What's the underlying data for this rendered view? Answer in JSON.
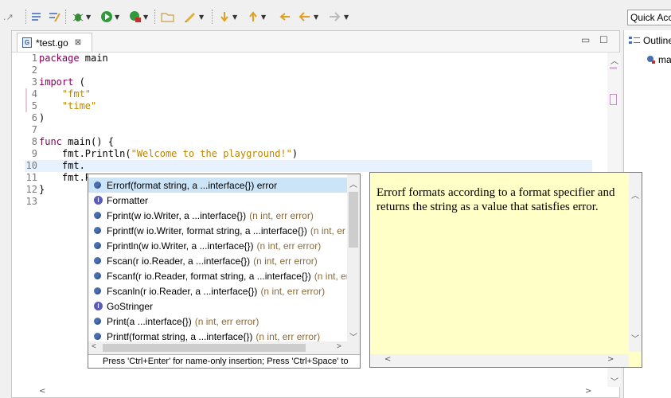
{
  "toolbar": {
    "quick_access": "Quick Acc",
    "icons": [
      "undo-redo-icon",
      "format-icon",
      "annotation-icon",
      "debug-icon",
      "run-icon",
      "run-config-icon",
      "new-folder-icon",
      "pen-icon",
      "next-annotation-icon",
      "prev-annotation-icon",
      "back-icon",
      "forward-icon"
    ]
  },
  "editor": {
    "tab_title": "*test.go",
    "tab_icon": "G",
    "tab_close": "⊠",
    "lines": [
      {
        "n": "1",
        "text": "package main"
      },
      {
        "n": "2",
        "text": ""
      },
      {
        "n": "3",
        "text": "import ("
      },
      {
        "n": "4",
        "text": "    \"fmt\""
      },
      {
        "n": "5",
        "text": "    \"time\""
      },
      {
        "n": "6",
        "text": ")"
      },
      {
        "n": "7",
        "text": ""
      },
      {
        "n": "8",
        "text": "func main() {"
      },
      {
        "n": "9",
        "text": "    fmt.Println(\"Welcome to the playground!\")"
      },
      {
        "n": "10",
        "text": "    fmt."
      },
      {
        "n": "11",
        "text": "    fmt.P"
      },
      {
        "n": "12",
        "text": "}"
      },
      {
        "n": "13",
        "text": ""
      }
    ]
  },
  "outline": {
    "title": "Outline",
    "item": "ma"
  },
  "completion": {
    "items": [
      {
        "kind": "func",
        "name": "Errorf(format string, a ...interface{}) error",
        "ret": ""
      },
      {
        "kind": "iface",
        "name": "Formatter",
        "ret": ""
      },
      {
        "kind": "func",
        "name": "Fprint(w io.Writer, a ...interface{})",
        "ret": "(n int, err error)"
      },
      {
        "kind": "func",
        "name": "Fprintf(w io.Writer, format string, a ...interface{})",
        "ret": "(n int, er"
      },
      {
        "kind": "func",
        "name": "Fprintln(w io.Writer, a ...interface{})",
        "ret": "(n int, err error)"
      },
      {
        "kind": "func",
        "name": "Fscan(r io.Reader, a ...interface{})",
        "ret": "(n int, err error)"
      },
      {
        "kind": "func",
        "name": "Fscanf(r io.Reader, format string, a ...interface{})",
        "ret": "(n int, err"
      },
      {
        "kind": "func",
        "name": "Fscanln(r io.Reader, a ...interface{})",
        "ret": "(n int, err error)"
      },
      {
        "kind": "iface",
        "name": "GoStringer",
        "ret": ""
      },
      {
        "kind": "func",
        "name": "Print(a ...interface{})",
        "ret": "(n int, err error)"
      },
      {
        "kind": "func",
        "name": "Printf(format string, a ...interface{})",
        "ret": "(n int, err error)"
      }
    ],
    "status": "Press 'Ctrl+Enter' for name-only insertion; Press 'Ctrl+Space' to"
  },
  "doc": {
    "text": "Errorf formats according to a format specifier and returns the string as a value that satisfies error."
  },
  "colors": {
    "selection": "#cce4f7",
    "doc_bg": "#ffffc8",
    "keyword": "#7f0055",
    "string": "#b8860b"
  }
}
